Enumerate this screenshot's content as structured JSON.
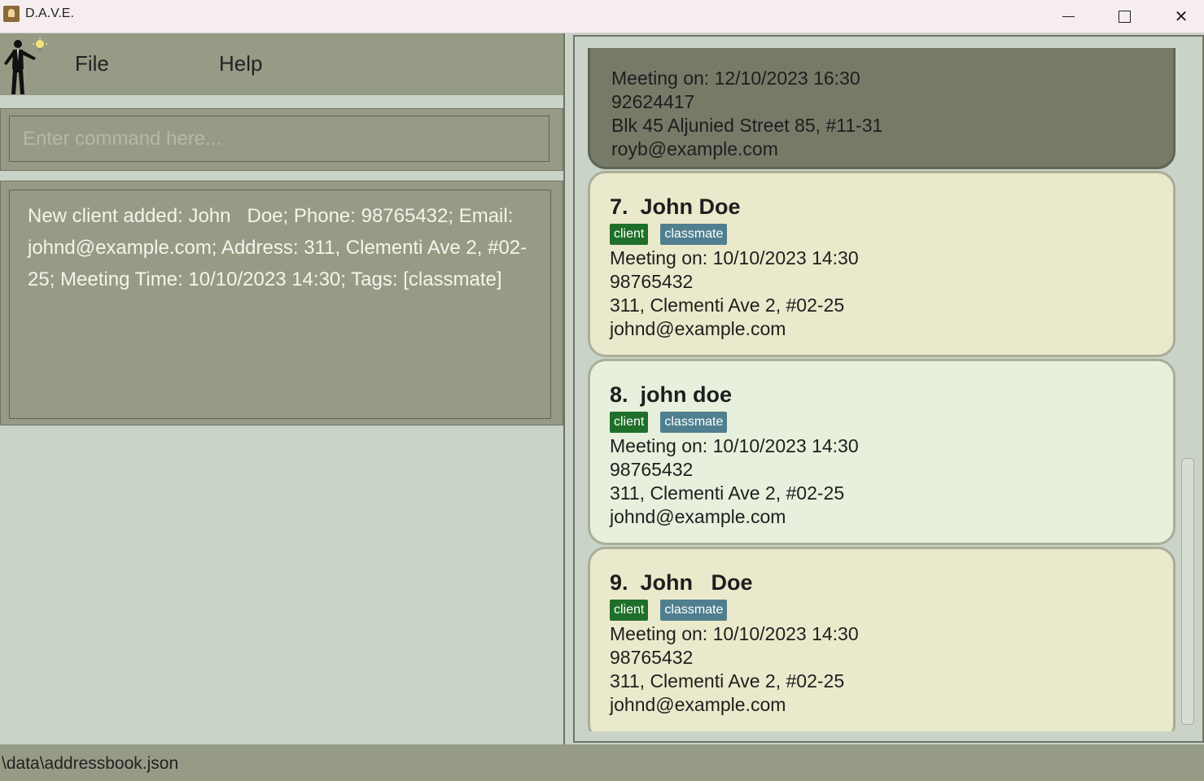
{
  "window": {
    "title": "D.A.V.E.",
    "min_icon": "minimize-icon",
    "max_icon": "maximize-icon",
    "close_icon": "close-icon",
    "close_glyph": "✕"
  },
  "menu": {
    "file": "File",
    "help": "Help"
  },
  "command": {
    "placeholder": "Enter command here...",
    "value": ""
  },
  "result": {
    "text": "New client added: John   Doe; Phone: 98765432; Email: johnd@example.com; Address: 311, Clementi Ave 2, #02-25; Meeting Time: 10/10/2023 14:30; Tags: [classmate]"
  },
  "cards": [
    {
      "name": "",
      "meeting": "Meeting on: 12/10/2023 16:30",
      "phone": "92624417",
      "address": "Blk 45 Aljunied Street 85, #11-31",
      "email": "royb@example.com"
    },
    {
      "name": "7.  John Doe",
      "tags": [
        "client",
        "classmate"
      ],
      "meeting": "Meeting on: 10/10/2023 14:30",
      "phone": "98765432",
      "address": "311, Clementi Ave 2, #02-25",
      "email": "johnd@example.com"
    },
    {
      "name": "8.  john doe",
      "tags": [
        "client",
        "classmate"
      ],
      "meeting": "Meeting on: 10/10/2023 14:30",
      "phone": "98765432",
      "address": "311, Clementi Ave 2, #02-25",
      "email": "johnd@example.com"
    },
    {
      "name": "9.  John   Doe",
      "tags": [
        "client",
        "classmate"
      ],
      "meeting": "Meeting on: 10/10/2023 14:30",
      "phone": "98765432",
      "address": "311, Clementi Ave 2, #02-25",
      "email": "johnd@example.com"
    }
  ],
  "status": {
    "path": "\\data\\addressbook.json"
  },
  "colors": {
    "client_tag": "#1f6f2a",
    "classmate_tag": "#4f7f8f",
    "panel": "#969b86"
  }
}
